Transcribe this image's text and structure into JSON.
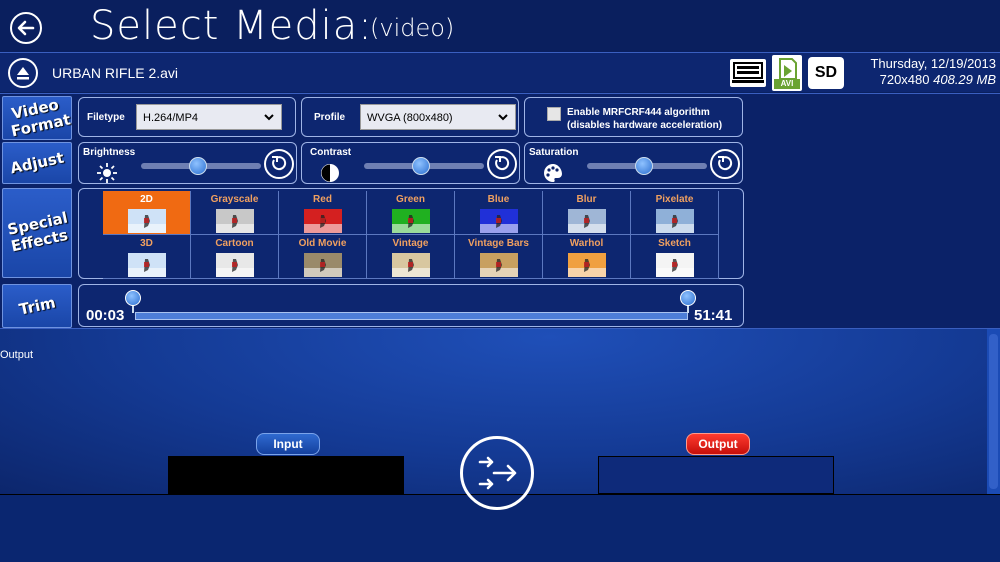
{
  "header": {
    "title": "Select Media:",
    "subtitle": "(video)"
  },
  "file": {
    "name": "URBAN RIFLE 2.avi",
    "date": "Thursday, 12/19/2013",
    "resolution": "720x480",
    "size": "408.29 MB",
    "avi_tag": "AVI",
    "sd_badge": "SD"
  },
  "rows": {
    "video_format": "Video Format",
    "adjust": "Adjust",
    "special_effects": "Special Effects",
    "trim": "Trim"
  },
  "video_format": {
    "filetype_label": "Filetype",
    "filetype_value": "H.264/MP4",
    "profile_label": "Profile",
    "profile_value": "WVGA (800x480)",
    "algo_line1": "Enable MRFCRF444 algorithm",
    "algo_line2": "(disables hardware acceleration)"
  },
  "adjust": {
    "brightness_label": "Brightness",
    "contrast_label": "Contrast",
    "saturation_label": "Saturation",
    "brightness_value": 0.5,
    "contrast_value": 0.5,
    "saturation_value": 0.5
  },
  "effects": [
    {
      "name": "2D",
      "active": true
    },
    {
      "name": "Grayscale"
    },
    {
      "name": "Red"
    },
    {
      "name": "Green"
    },
    {
      "name": "Blue"
    },
    {
      "name": "Blur"
    },
    {
      "name": "Pixelate"
    },
    {
      "name": "3D"
    },
    {
      "name": "Cartoon"
    },
    {
      "name": "Old Movie"
    },
    {
      "name": "Vintage"
    },
    {
      "name": "Vintage Bars"
    },
    {
      "name": "Warhol"
    },
    {
      "name": "Sketch"
    }
  ],
  "trim": {
    "start": "00:03",
    "end": "51:41"
  },
  "output_area": {
    "section_label": "Output",
    "input_label": "Input",
    "output_label": "Output"
  },
  "colors": {
    "accent_orange": "#f06a12",
    "output_red": "#d8140e",
    "input_blue": "#2f6ad0"
  }
}
